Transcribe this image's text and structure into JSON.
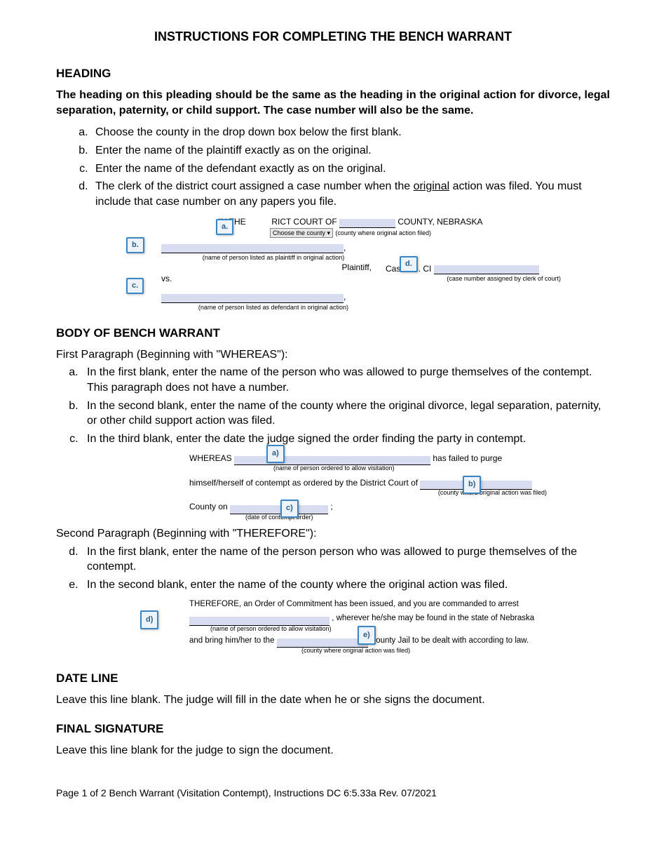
{
  "title": "INSTRUCTIONS FOR COMPLETING THE BENCH WARRANT",
  "sections": {
    "heading": {
      "title": "HEADING",
      "intro": "The heading on this pleading should be the same as the heading in the original action for divorce, legal separation, paternity, or child support. The case number will also be the same.",
      "items": {
        "a": "Choose the county in the drop down box below the first blank.",
        "b": "Enter the name of the plaintiff exactly as on the original.",
        "c": "Enter the name of the defendant exactly as on the original.",
        "d_pre": "The clerk of the district court assigned a case number when the ",
        "d_underline": "original",
        "d_post": " action was filed. You must include that case number on any papers you file."
      },
      "fig": {
        "prefix": "IN THE",
        "mid": "RICT COURT OF",
        "dropdown": "Choose the county ▾",
        "countyCap": "(county where original action filed)",
        "suffix": "COUNTY, NEBRASKA",
        "plaintiffCap": "(name of person listed as plaintiff in original action)",
        "plaintiffLabel": "Plaintiff,",
        "vs": "vs.",
        "caseNo": "Case No. CI",
        "caseCap": "(case number assigned by clerk of court)",
        "defendantCap": "(name of person listed as defendant in original action)",
        "labels": {
          "a": "a.",
          "b": "b.",
          "c": "c.",
          "d": "d."
        }
      }
    },
    "body": {
      "title": "BODY OF BENCH WARRANT",
      "firstPara": "First Paragraph (Beginning with \"WHEREAS\"):",
      "items1": {
        "a": "In the first blank, enter the name of the person who was allowed to purge themselves of the contempt. This paragraph does not have a number.",
        "b": "In the second blank, enter the name of the county where the original divorce, legal separation, paternity, or other child support action was filed.",
        "c": "In the third blank, enter the date the judge signed the order finding the party in contempt."
      },
      "whereasFig": {
        "w": "WHEREAS",
        "tail1": "has failed to purge",
        "cap1": "(name of person ordered to allow visitation)",
        "line2": "himself/herself of contempt as ordered by the District Court of",
        "cap2": "(county where original action was filed)",
        "line3pre": "County on",
        "cap3": "(date of contempt order)",
        "labels": {
          "a": "a)",
          "b": "b)",
          "c": "c)"
        }
      },
      "secondPara": "Second Paragraph (Beginning with \"THEREFORE\"):",
      "items2": {
        "d": "In the first blank, enter the name of the person person who was allowed to purge themselves of the contempt.",
        "e": "In the second blank, enter the name of the county where the original action was filed."
      },
      "thereforeFig": {
        "line1": "THEREFORE, an Order of Commitment has been issued, and you are commanded to arrest",
        "line2tail": ", wherever he/she may be found in the state of Nebraska",
        "cap1": "(name of person ordered to allow visitation)",
        "line3pre": "and bring him/her to the",
        "line3post": "County Jail to be dealt with according to law.",
        "cap2": "(county where original action was filed)",
        "labels": {
          "d": "d)",
          "e": "e)"
        }
      }
    },
    "dateLine": {
      "title": "DATE LINE",
      "text": "Leave this line blank. The judge will fill in the date when he or she signs the document."
    },
    "finalSig": {
      "title": "FINAL SIGNATURE",
      "text": "Leave this line blank for the judge to sign the document."
    }
  },
  "footer": "Page 1 of 2 Bench Warrant (Visitation Contempt), Instructions DC 6:5.33a Rev. 07/2021"
}
